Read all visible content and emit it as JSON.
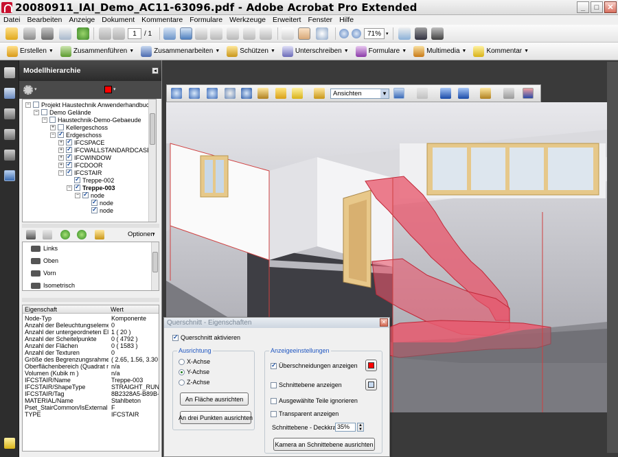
{
  "window": {
    "title": "20080911_IAI_Demo_AC11-63096.pdf - Adobe Acrobat Pro Extended"
  },
  "menu": [
    "Datei",
    "Bearbeiten",
    "Anzeige",
    "Dokument",
    "Kommentare",
    "Formulare",
    "Werkzeuge",
    "Erweitert",
    "Fenster",
    "Hilfe"
  ],
  "toolbar": {
    "page_current": "1",
    "page_total": "/ 1",
    "zoom": "71%"
  },
  "tasks": [
    "Erstellen",
    "Zusammenführen",
    "Zusammenarbeiten",
    "Schützen",
    "Unterschreiben",
    "Formulare",
    "Multimedia",
    "Kommentar"
  ],
  "panel": {
    "title": "Modellhierarchie",
    "tree": [
      {
        "label": "Projekt Haustechnik Anwenderhandbuch",
        "checked": false
      },
      {
        "label": "Demo Gelände",
        "checked": false
      },
      {
        "label": "Haustechnik-Demo-Gebaeude",
        "checked": false
      },
      {
        "label": "Kellergeschoss",
        "checked": false
      },
      {
        "label": "Erdgeschoss",
        "checked": true
      },
      {
        "label": "IFCSPACE",
        "checked": true
      },
      {
        "label": "IFCWALLSTANDARDCASE",
        "checked": true
      },
      {
        "label": "IFCWINDOW",
        "checked": true
      },
      {
        "label": "IFCDOOR",
        "checked": true
      },
      {
        "label": "IFCSTAIR",
        "checked": true
      },
      {
        "label": "Treppe-002",
        "checked": true
      },
      {
        "label": "Treppe-003",
        "checked": true
      },
      {
        "label": "node",
        "checked": true
      },
      {
        "label": "node",
        "checked": true
      },
      {
        "label": "node",
        "checked": true
      }
    ],
    "views_options": "Optionen",
    "views": [
      "Links",
      "Oben",
      "Vorn",
      "Isometrisch"
    ],
    "props_header": {
      "key": "Eigenschaft",
      "value": "Wert"
    },
    "properties": [
      {
        "k": "Node-Typ",
        "v": "Komponente"
      },
      {
        "k": "Anzahl der Beleuchtungselemente",
        "v": "0"
      },
      {
        "k": "Anzahl der untergeordneten Ele...",
        "v": "1 ( 20 )"
      },
      {
        "k": "Anzahl der Scheitelpunkte",
        "v": "0 ( 4792 )"
      },
      {
        "k": "Anzahl der Flächen",
        "v": "0 ( 1583 )"
      },
      {
        "k": "Anzahl der Texturen",
        "v": "0"
      },
      {
        "k": "Größe des Begrenzungsrahmens ...",
        "v": "( 2.65, 1.56, 3.30 )"
      },
      {
        "k": "Oberflächenbereich (Quadrat m )",
        "v": "n/a"
      },
      {
        "k": "Volumen (Kubik m )",
        "v": "n/a"
      },
      {
        "k": "IFCSTAIR/Name",
        "v": "Treppe-003"
      },
      {
        "k": "IFCSTAIR/ShapeType",
        "v": "STRAIGHT_RUN_STAI"
      },
      {
        "k": "IFCSTAIR/Tag",
        "v": "8B2328A5-B89B-4CD"
      },
      {
        "k": "MATERIAL/Name",
        "v": "Stahlbeton"
      },
      {
        "k": "Pset_StairCommon/IsExternal",
        "v": "F"
      },
      {
        "k": "TYPE",
        "v": "IFCSTAIR"
      }
    ]
  },
  "toolbar3d": {
    "view_select": "Ansichten"
  },
  "dialog": {
    "title": "Querschnitt - Eigenschaften",
    "enable": "Querschnitt aktivieren",
    "alignment_title": "Ausrichtung",
    "axes": [
      "X-Achse",
      "Y-Achse",
      "Z-Achse"
    ],
    "btn_align_face": "An Fläche ausrichten",
    "btn_align_points": "An drei Punkten ausrichten",
    "display_title": "Anzeigeeinstellungen",
    "opt_intersections": "Überschneidungen anzeigen",
    "opt_plane": "Schnittebene anzeigen",
    "opt_ignore": "Ausgewählte Teile ignorieren",
    "opt_transparent": "Transparent anzeigen",
    "opacity_label": "Schnittebene - Deckkraft:",
    "opacity_value": "35%",
    "btn_camera": "Kamera an Schnittebene ausrichten"
  }
}
